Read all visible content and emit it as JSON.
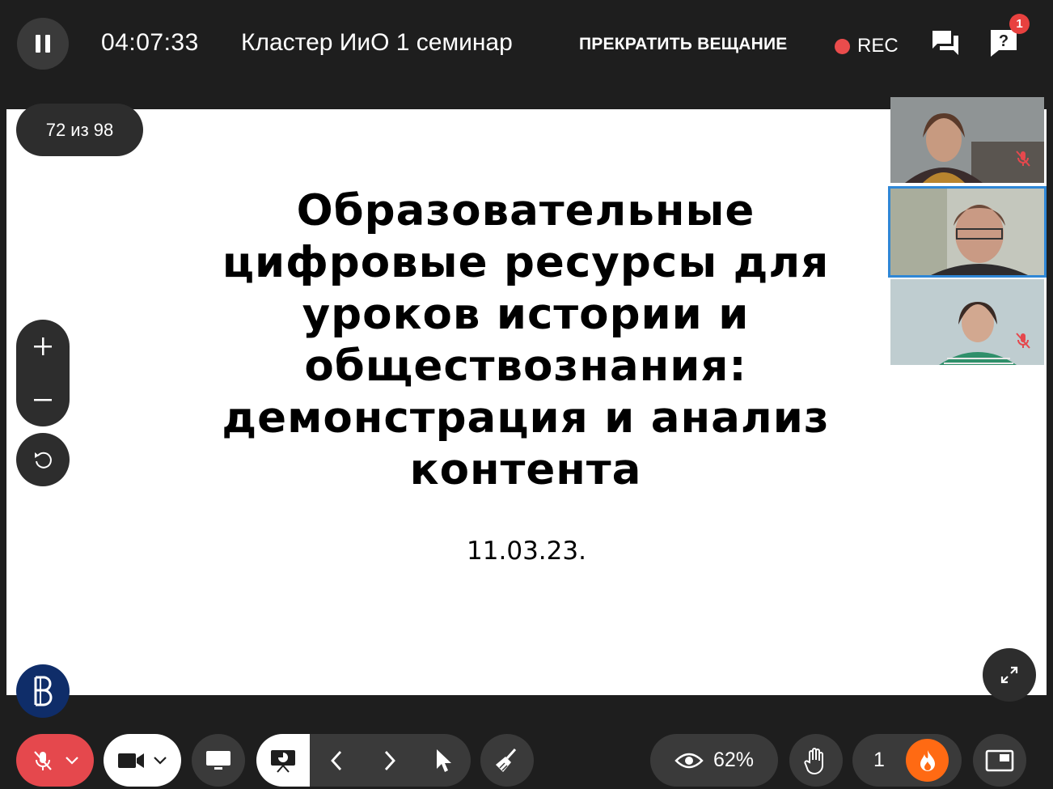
{
  "header": {
    "timer": "04:07:33",
    "title": "Кластер ИиО 1 семинар",
    "stop_broadcast_label": "ПРЕКРАТИТЬ ВЕЩАНИЕ",
    "rec_label": "REC",
    "questions_badge": "1",
    "pause_icon": "pause-icon",
    "chat_icon": "chat-icon",
    "questions_icon": "question-icon",
    "rec_color": "#ea4c4c"
  },
  "slide": {
    "page_counter": "72 из 98",
    "title": "Образовательные цифровые ресурсы для уроков истории и обществознания: демонстрация и анализ контента",
    "date": "11.03.23."
  },
  "participants": [
    {
      "muted": true,
      "active": false
    },
    {
      "muted": false,
      "active": true
    },
    {
      "muted": true,
      "active": false
    }
  ],
  "toolbar": {
    "attention_percent": "62%",
    "reactions_count": "1",
    "mic_color": "#e5484d",
    "fire_color": "#ff6a13",
    "active_speaker_color": "#2f87d6"
  }
}
